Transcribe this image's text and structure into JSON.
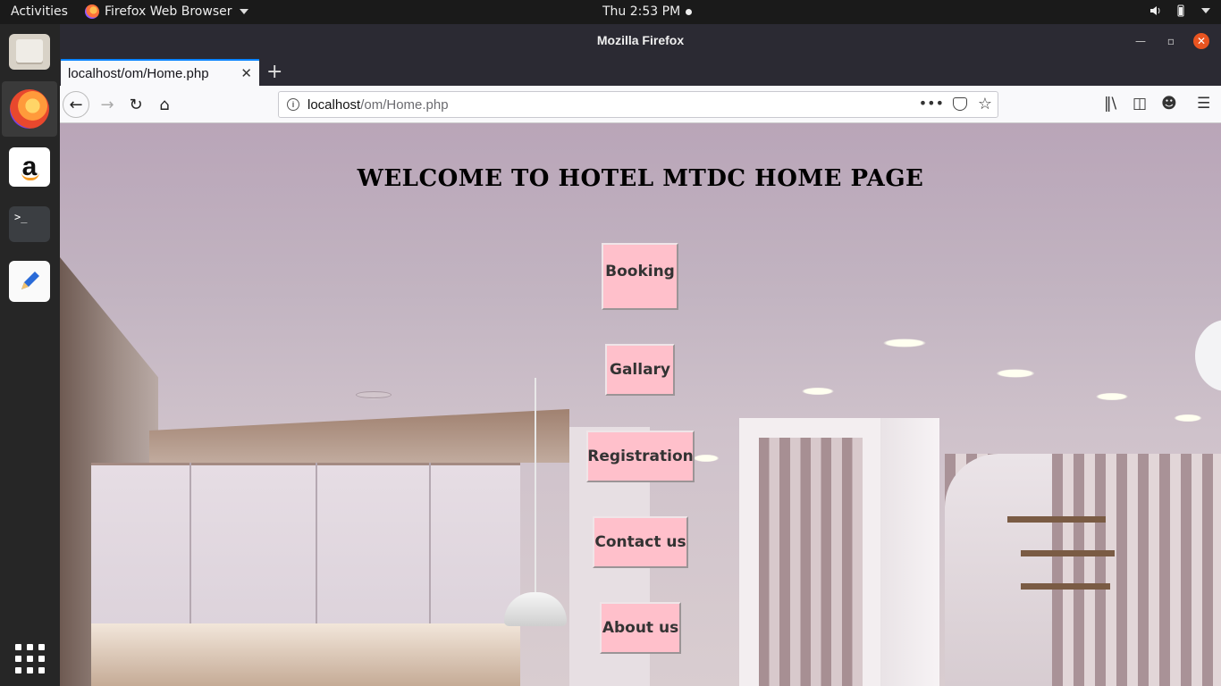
{
  "system_bar": {
    "activities": "Activities",
    "app_name": "Firefox Web Browser",
    "clock": "Thu  2:53 PM"
  },
  "dock": {
    "apps": [
      "files-icon",
      "firefox-icon",
      "amazon-icon",
      "terminal-icon",
      "text-editor-icon",
      "show-applications-icon"
    ],
    "amazon_glyph": "a",
    "terminal_glyph": ">_"
  },
  "window": {
    "title": "Mozilla Firefox"
  },
  "browser": {
    "tab_title": "localhost/om/Home.php",
    "url_host": "localhost",
    "url_path": "/om/Home.php"
  },
  "page": {
    "heading": "WELCOME TO HOTEL MTDC HOME PAGE",
    "buttons": {
      "booking": "Booking",
      "gallary": "Gallary",
      "registration": "Registration",
      "contact": "Contact us",
      "about": "About us"
    }
  },
  "colors": {
    "button_bg": "#ffc0cb",
    "accent": "#e95420"
  }
}
